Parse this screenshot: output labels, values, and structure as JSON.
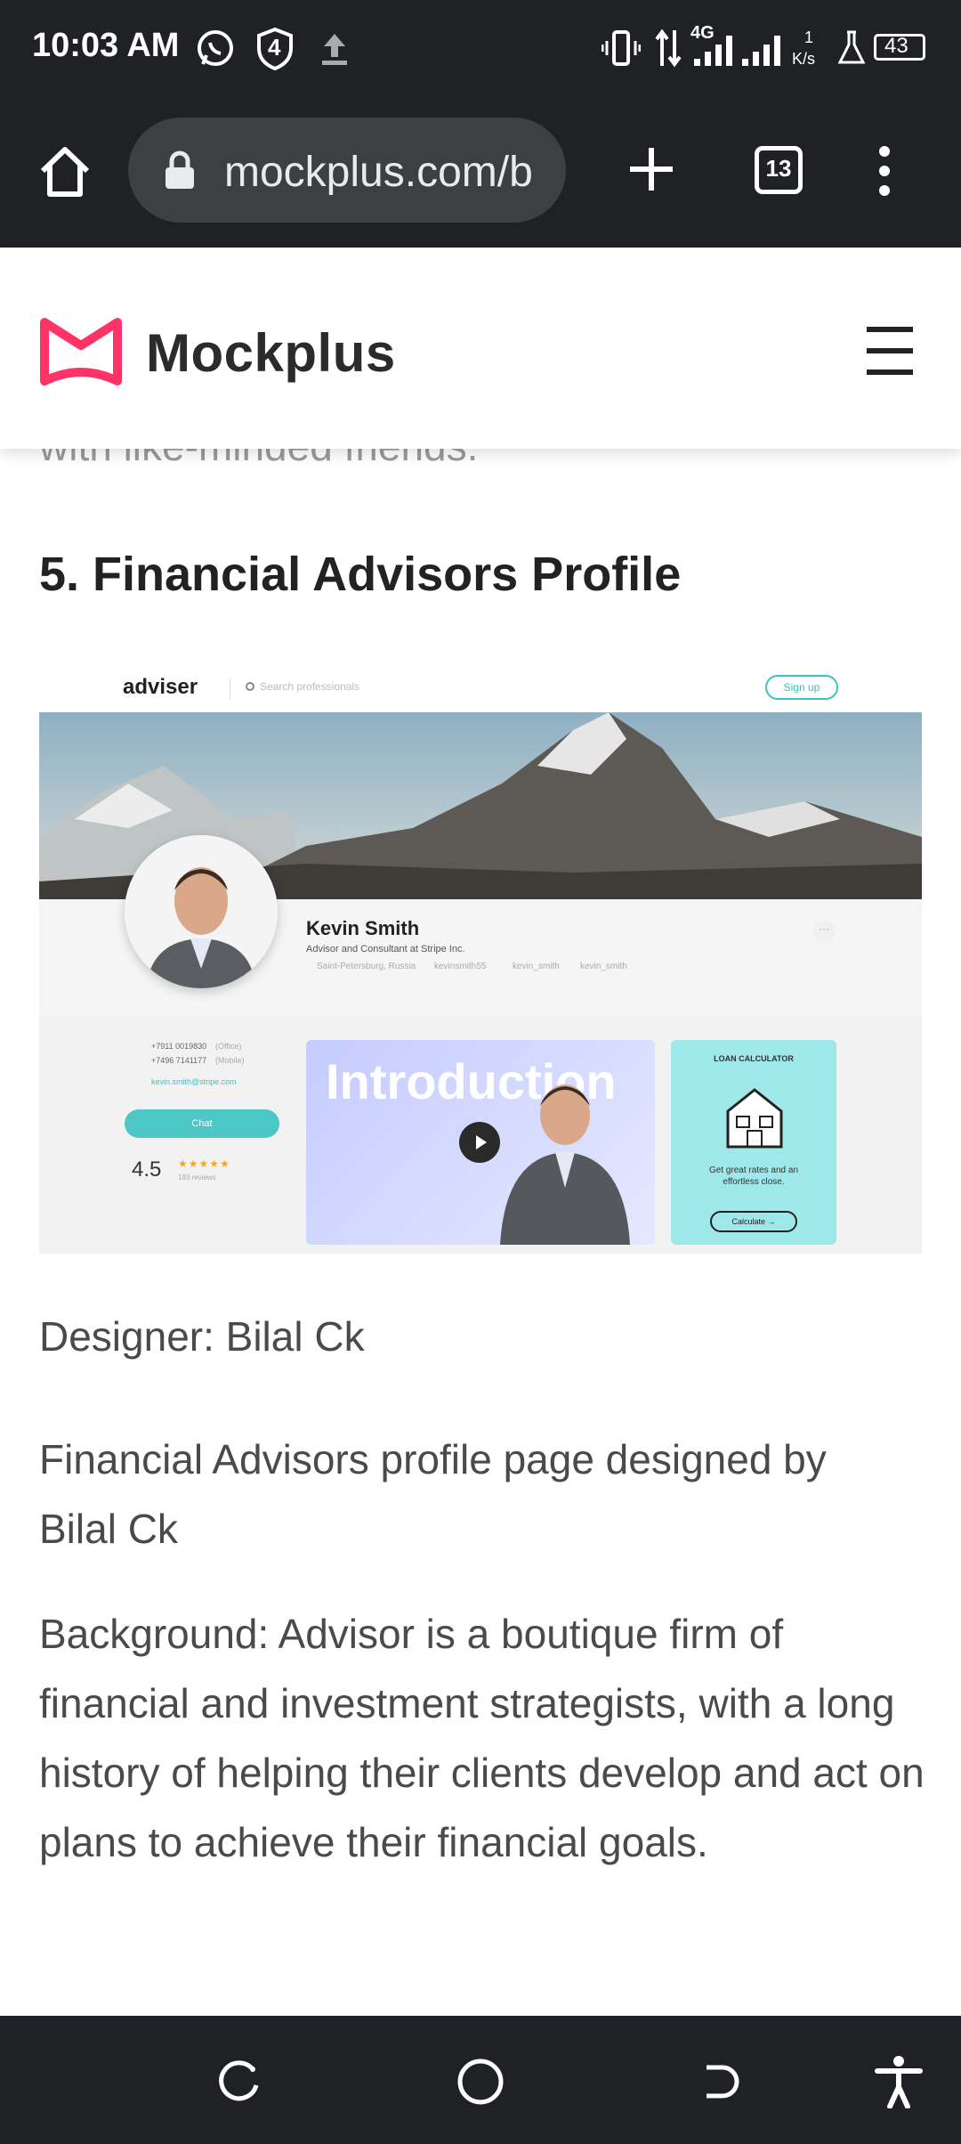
{
  "status_bar": {
    "time": "10:03 AM",
    "notification_count": "4",
    "network": "4G",
    "speed_value": "1",
    "speed_unit": "K/s",
    "battery": "43"
  },
  "browser": {
    "url": "mockplus.com/b",
    "tab_count": "13"
  },
  "site_header": {
    "brand": "Mockplus",
    "brand_color": "#ff3366"
  },
  "article": {
    "faded_text": "with like-minded friends.",
    "heading": "5. Financial Advisors Profile",
    "designer": "Designer: Bilal Ck",
    "description": "Financial Advisors profile page designed by Bilal Ck",
    "background": "Background: Advisor is a boutique firm of financial and investment strategists, with a long history of helping their clients develop and act on plans to achieve their financial goals."
  },
  "preview": {
    "logo": "adviser",
    "search_placeholder": "Search professionals",
    "signup": "Sign up",
    "name": "Kevin Smith",
    "title": "Advisor and Consultant at Stripe Inc.",
    "location": "Saint-Petersburg, Russia",
    "social": [
      "kevinsmith55",
      "kevin_smith",
      "kevin_smith"
    ],
    "phone_office": "+7911 0019830",
    "phone_office_label": "(Office)",
    "phone_mobile": "+7496 7141177",
    "phone_mobile_label": "(Mobile)",
    "email": "kevin.smith@stripe.com",
    "chat": "Chat",
    "rating": "4.5",
    "reviews": "193 reviews",
    "video_title": "Introduction",
    "loan_title": "LOAN CALCULATOR",
    "loan_text": "Get great rates and an effortless close.",
    "loan_button": "Calculate →"
  }
}
